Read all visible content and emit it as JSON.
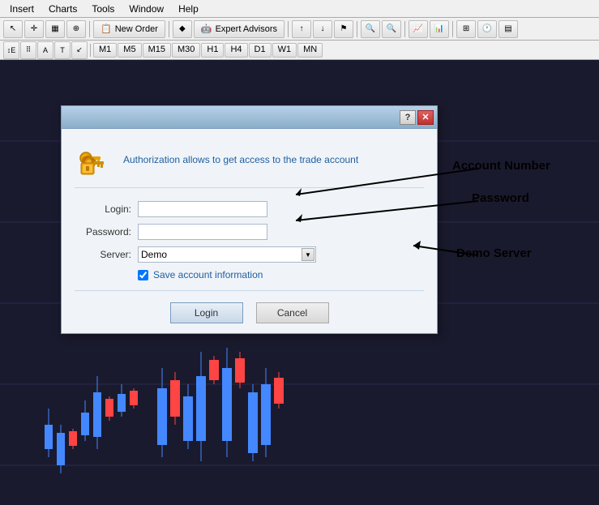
{
  "menu": {
    "items": [
      "Insert",
      "Charts",
      "Tools",
      "Window",
      "Help"
    ]
  },
  "toolbar": {
    "new_order_label": "New Order",
    "expert_advisors_label": "Expert Advisors",
    "timeframes": [
      "M1",
      "M5",
      "M15",
      "M30",
      "H1",
      "H4",
      "D1",
      "W1",
      "MN"
    ]
  },
  "dialog": {
    "title": "",
    "help_btn": "?",
    "close_btn": "✕",
    "header_text": "Authorization allows to get access to the trade account",
    "login_label": "Login:",
    "password_label": "Password:",
    "server_label": "Server:",
    "server_value": "Demo",
    "save_checkbox_label": "Save account information",
    "login_btn": "Login",
    "cancel_btn": "Cancel"
  },
  "annotations": {
    "account_number": "Account Number",
    "password": "Password",
    "demo_server": "Demo Server"
  }
}
